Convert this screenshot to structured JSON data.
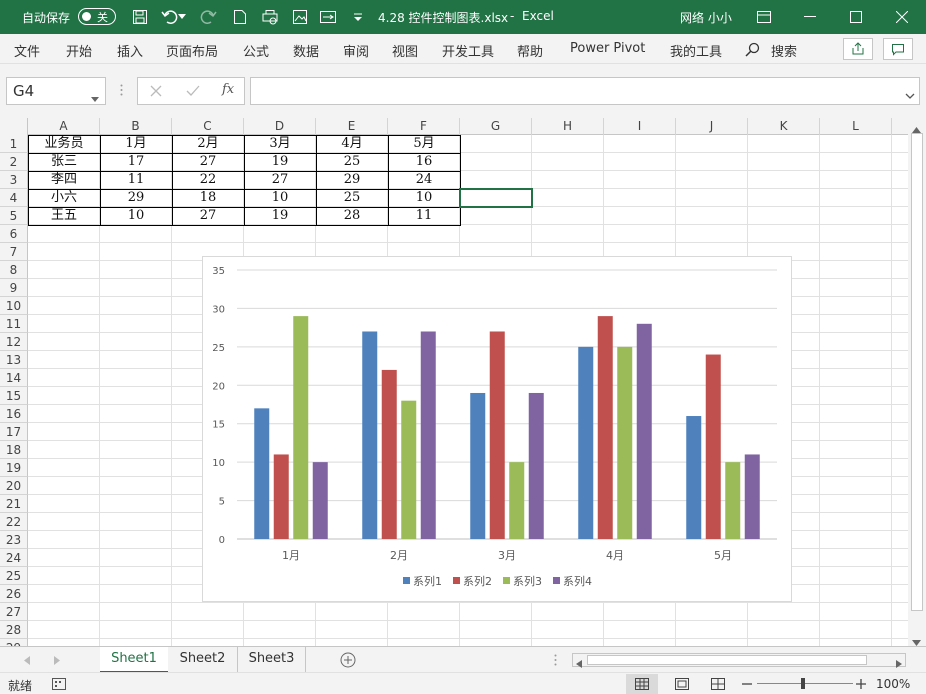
{
  "titlebar": {
    "autosave_label": "自动保存",
    "autosave_state": "关",
    "file_title": "4.28 控件控制图表.xlsx",
    "app_name": "Excel",
    "user_name": "网络 小小",
    "separator": "-"
  },
  "menu": [
    "文件",
    "开始",
    "插入",
    "页面布局",
    "公式",
    "数据",
    "审阅",
    "视图",
    "开发工具",
    "帮助",
    "Power Pivot",
    "我的工具",
    "搜索"
  ],
  "namebox": {
    "value": "G4"
  },
  "formula": {
    "fx_label": "fx",
    "value": ""
  },
  "columns": [
    "A",
    "B",
    "C",
    "D",
    "E",
    "F",
    "G",
    "H",
    "I",
    "J",
    "K",
    "L"
  ],
  "rows": [
    "1",
    "2",
    "3",
    "4",
    "5",
    "6",
    "7",
    "8",
    "9",
    "10",
    "11",
    "12",
    "13",
    "14",
    "15",
    "16",
    "17",
    "18",
    "19",
    "20",
    "21",
    "22",
    "23",
    "24",
    "25",
    "26",
    "27",
    "28",
    "29"
  ],
  "table": {
    "header": [
      "业务员",
      "1月",
      "2月",
      "3月",
      "4月",
      "5月"
    ],
    "body": [
      [
        "张三",
        "17",
        "27",
        "19",
        "25",
        "16"
      ],
      [
        "李四",
        "11",
        "22",
        "27",
        "29",
        "24"
      ],
      [
        "小六",
        "29",
        "18",
        "10",
        "25",
        "10"
      ],
      [
        "王五",
        "10",
        "27",
        "19",
        "28",
        "11"
      ]
    ]
  },
  "chart_data": {
    "type": "bar",
    "categories": [
      "1月",
      "2月",
      "3月",
      "4月",
      "5月"
    ],
    "series": [
      {
        "name": "系列1",
        "values": [
          17,
          27,
          19,
          25,
          16
        ],
        "color": "#4f81bd"
      },
      {
        "name": "系列2",
        "values": [
          11,
          22,
          27,
          29,
          24
        ],
        "color": "#c0504d"
      },
      {
        "name": "系列3",
        "values": [
          29,
          18,
          10,
          25,
          10
        ],
        "color": "#9bbb59"
      },
      {
        "name": "系列4",
        "values": [
          10,
          27,
          19,
          28,
          11
        ],
        "color": "#8064a2"
      }
    ],
    "ylim": [
      0,
      35
    ],
    "yticks": [
      "0",
      "5",
      "10",
      "15",
      "20",
      "25",
      "30",
      "35"
    ],
    "grid": true,
    "legend": "bottom"
  },
  "sheets": [
    "Sheet1",
    "Sheet2",
    "Sheet3"
  ],
  "active_sheet": "Sheet1",
  "status": {
    "ready": "就绪",
    "zoom": "100%"
  },
  "colors": {
    "accent": "#217346"
  }
}
